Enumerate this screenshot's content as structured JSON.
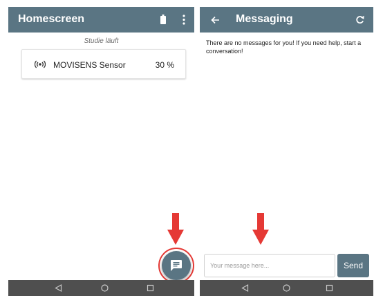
{
  "homescreen": {
    "title": "Homescreen",
    "status": "Studie läuft",
    "icons": {
      "battery": "battery-icon",
      "menu": "overflow-menu-icon"
    },
    "sensor": {
      "icon": "broadcast-icon",
      "name": "MOVISENS Sensor",
      "percent": "30 %"
    },
    "fab": {
      "icon": "chat-message-icon"
    }
  },
  "messaging": {
    "title": "Messaging",
    "icons": {
      "back": "back-arrow-icon",
      "refresh": "refresh-icon"
    },
    "empty_text": "There are no messages for you! If you need help, start a conversation!",
    "input": {
      "value": "",
      "placeholder": "Your message here..."
    },
    "send_label": "Send"
  },
  "navigation": {
    "buttons": [
      "back-triangle-icon",
      "home-circle-icon",
      "recents-square-icon"
    ]
  },
  "colors": {
    "app_bar": "#5a7583",
    "nav_bar": "#4f4f4f",
    "annotation": "#e53935",
    "surface": "#ffffff"
  }
}
